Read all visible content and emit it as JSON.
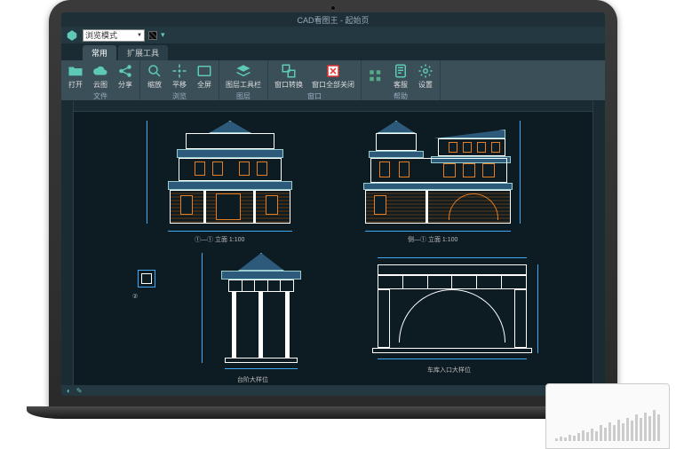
{
  "window": {
    "title": "CAD看图王 - 起始页"
  },
  "mode_selector": {
    "value": "浏览模式"
  },
  "tabs": [
    {
      "label": "常用",
      "active": true
    },
    {
      "label": "扩展工具",
      "active": false
    }
  ],
  "ribbon_groups": [
    {
      "label": "文件",
      "items": [
        {
          "icon": "folder-open-icon",
          "label": "打开"
        },
        {
          "icon": "cloud-icon",
          "label": "云图"
        },
        {
          "icon": "share-icon",
          "label": "分享"
        }
      ]
    },
    {
      "label": "浏览",
      "items": [
        {
          "icon": "zoom-icon",
          "label": "缩放"
        },
        {
          "icon": "pan-icon",
          "label": "平移"
        },
        {
          "icon": "fullscreen-icon",
          "label": "全屏"
        }
      ]
    },
    {
      "label": "图层",
      "items": [
        {
          "icon": "layers-icon",
          "label": "图层工具栏"
        }
      ]
    },
    {
      "label": "窗口",
      "items": [
        {
          "icon": "switch-window-icon",
          "label": "窗口转换"
        },
        {
          "icon": "close-all-icon",
          "label": "窗口全部关闭"
        }
      ]
    },
    {
      "label": "帮助",
      "items": [
        {
          "icon": "grid-icon",
          "label": ""
        },
        {
          "icon": "support-icon",
          "label": "客服"
        },
        {
          "icon": "settings-icon",
          "label": "设置"
        }
      ]
    }
  ],
  "drawing": {
    "elevation1_caption": "①—① 立面 1:100",
    "elevation2_caption": "侧—① 立面 1:100",
    "detail1_caption": "台阶大样位",
    "detail2_caption": "车库入口大样位",
    "small_detail": "②"
  },
  "colors": {
    "accent": "#5fc9b8",
    "dim": "#3fa9f5",
    "window": "#e67e22",
    "roof": "#2d5a7a"
  }
}
